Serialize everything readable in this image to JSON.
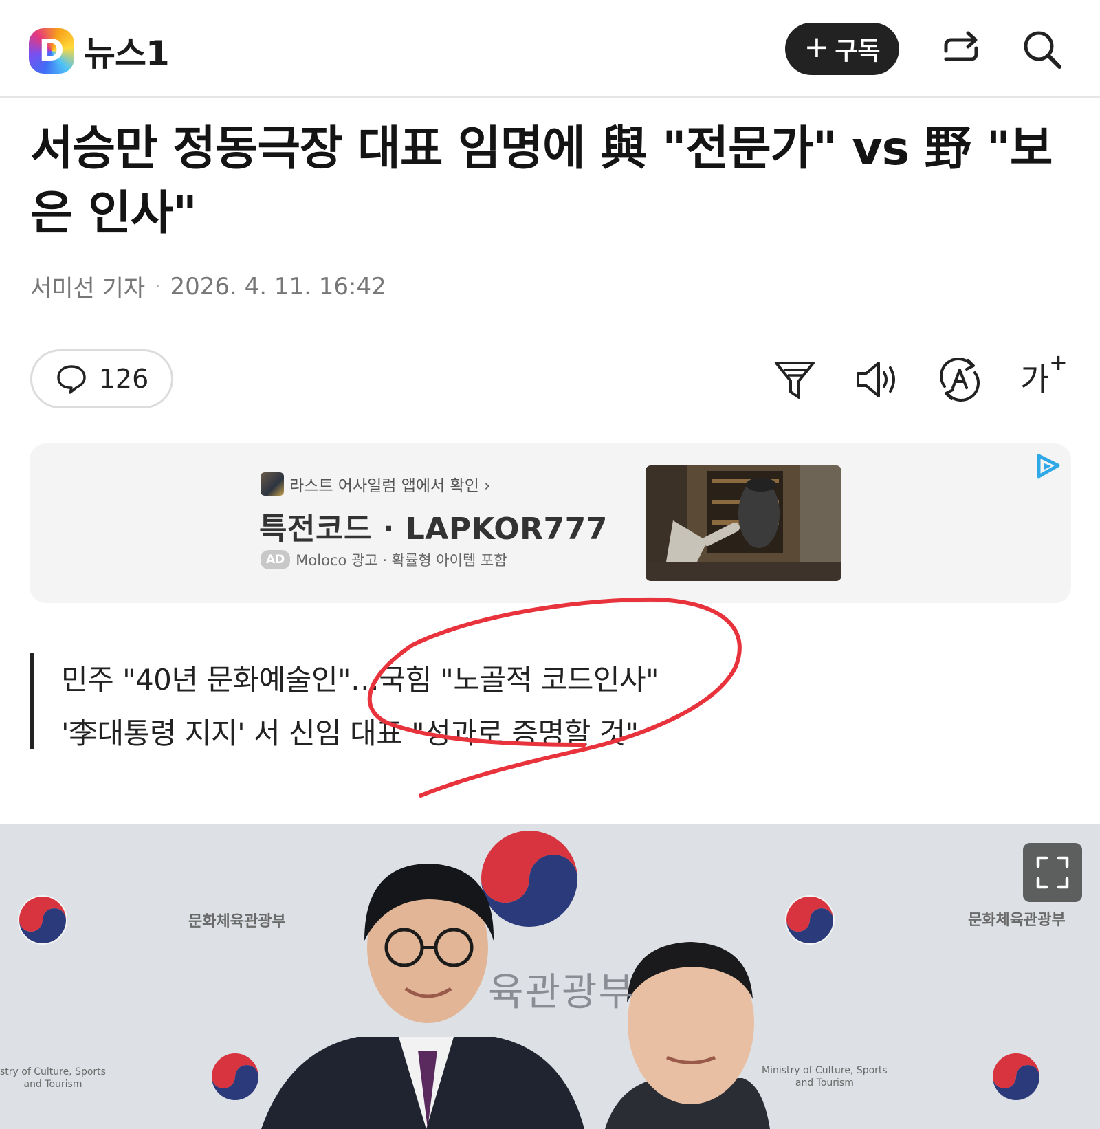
{
  "header": {
    "logo_mark": "D",
    "logo_text": "뉴스1",
    "subscribe_plus": "+",
    "subscribe_label": "구독",
    "icons": [
      "share-icon",
      "search-icon"
    ]
  },
  "article": {
    "headline": "서승만 정동극장 대표 임명에 與 \"전문가\" vs 野 \"보은 인사\"",
    "reporter": "서미선 기자",
    "separator": "·",
    "datetime": "2026. 4. 11. 16:42",
    "comment_count": "126",
    "tools": [
      "filter-icon",
      "speaker-icon",
      "translate-icon",
      "font-size-icon"
    ],
    "font_size_label": "가",
    "font_size_plus": "+"
  },
  "ad": {
    "app_line": "라스트 어사일럼 앱에서 확인 ›",
    "title": "특전코드 · LAPKOR777",
    "badge": "AD",
    "sub": "Moloco 광고 · 확률형 아이템 포함"
  },
  "summary": {
    "line1": "민주 \"40년 문화예술인\"…국힘 \"노골적 코드인사\"",
    "line2": "'李대통령 지지' 서 신임 대표 \"성과로 증명할 것\""
  },
  "photo": {
    "label_ko_1": "문화체육관광부",
    "label_ko_2": "문화체육관광부",
    "label_big": "육관광부",
    "label_en_1": "stry of Culture, Sports\nand Tourism",
    "label_en_2": "Ministry of Culture, Sports\nand Tourism"
  },
  "colors": {
    "accent_dark": "#222222",
    "annotation_red": "#e8323c",
    "ad_bg": "#f4f4f4",
    "ad_choices": "#2ea8e6"
  }
}
